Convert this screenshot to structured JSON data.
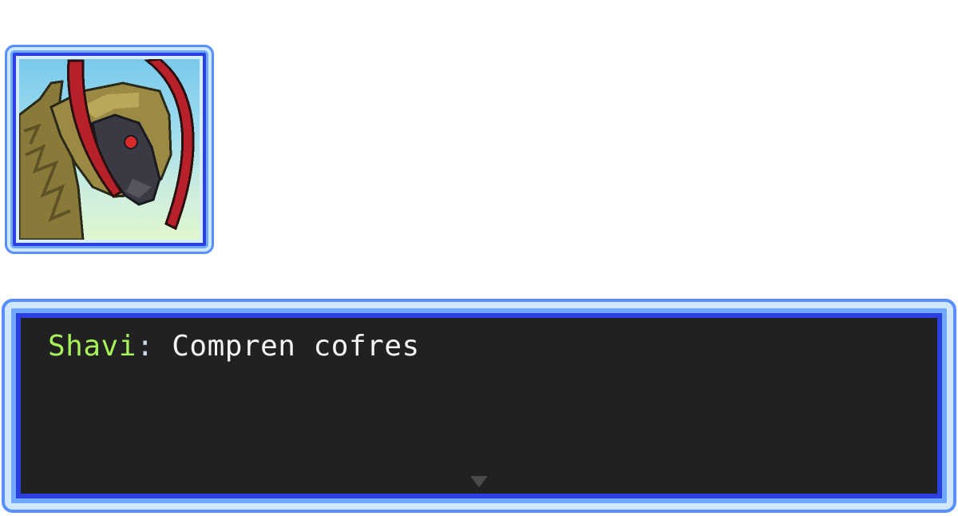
{
  "portrait": {
    "icon": "haxorus-portrait",
    "colors": {
      "frame_outer": "#5a8fff",
      "frame_light": "#cfe7ff",
      "frame_inner": "#2b40e0",
      "sky_top": "#79c9ec",
      "ground": "#dff7cf",
      "body": "#8a7a3a",
      "tusk_red": "#b8202a",
      "dark_gray": "#3a3a44",
      "eye": "#d82a2a"
    }
  },
  "dialog": {
    "speaker": "Shavi",
    "separator": ":",
    "message": " Compren cofres",
    "speaker_color": "#a6f25a",
    "text_color": "#f4f4f4",
    "background": "#212121",
    "advance_icon": "triangle-down-icon"
  }
}
